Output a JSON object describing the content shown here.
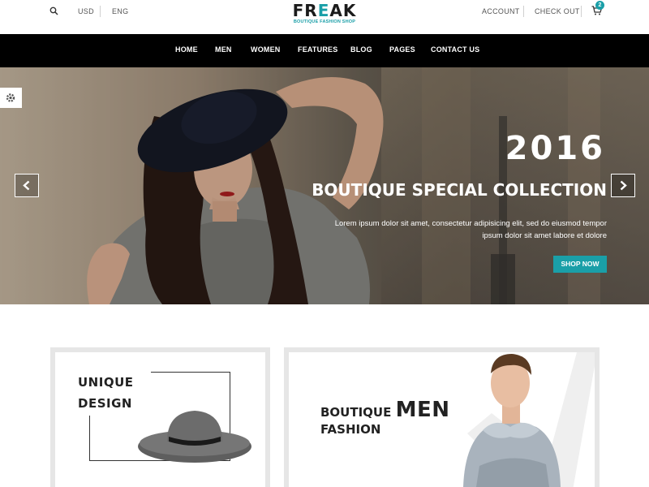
{
  "topbar": {
    "currency": "USD",
    "language": "ENG",
    "account": "ACCOUNT",
    "checkout": "CHECK OUT",
    "cart_count": "2"
  },
  "logo": {
    "name_part1": "FR",
    "name_accent": "E",
    "name_part2": "AK",
    "tagline": "BOUTIQUE FASHION SHOP"
  },
  "nav": {
    "items": [
      "HOME",
      "MEN",
      "WOMEN",
      "FEATURES",
      "BLOG",
      "PAGES",
      "CONTACT US"
    ]
  },
  "hero": {
    "year": "2016",
    "title": "BOUTIQUE SPECIAL COLLECTION",
    "text_line1": "Lorem ipsum dolor sit amet, consectetur adipisicing elit, sed do eiusmod tempor",
    "text_line2": "ipsum dolor sit amet labore et dolore",
    "button": "SHOP NOW"
  },
  "banners": {
    "left": {
      "line1": "UNIQUE",
      "line2": "DESIGN"
    },
    "right": {
      "line1_small": "BOUTIQUE",
      "line1_big": "MEN",
      "line2": "FASHION"
    }
  },
  "colors": {
    "accent": "#1a9fa8",
    "nav_bg": "#000000"
  },
  "icons": {
    "search": "search-icon",
    "cart": "cart-icon",
    "settings": "gear-icon",
    "prev": "chevron-left-icon",
    "next": "chevron-right-icon"
  }
}
